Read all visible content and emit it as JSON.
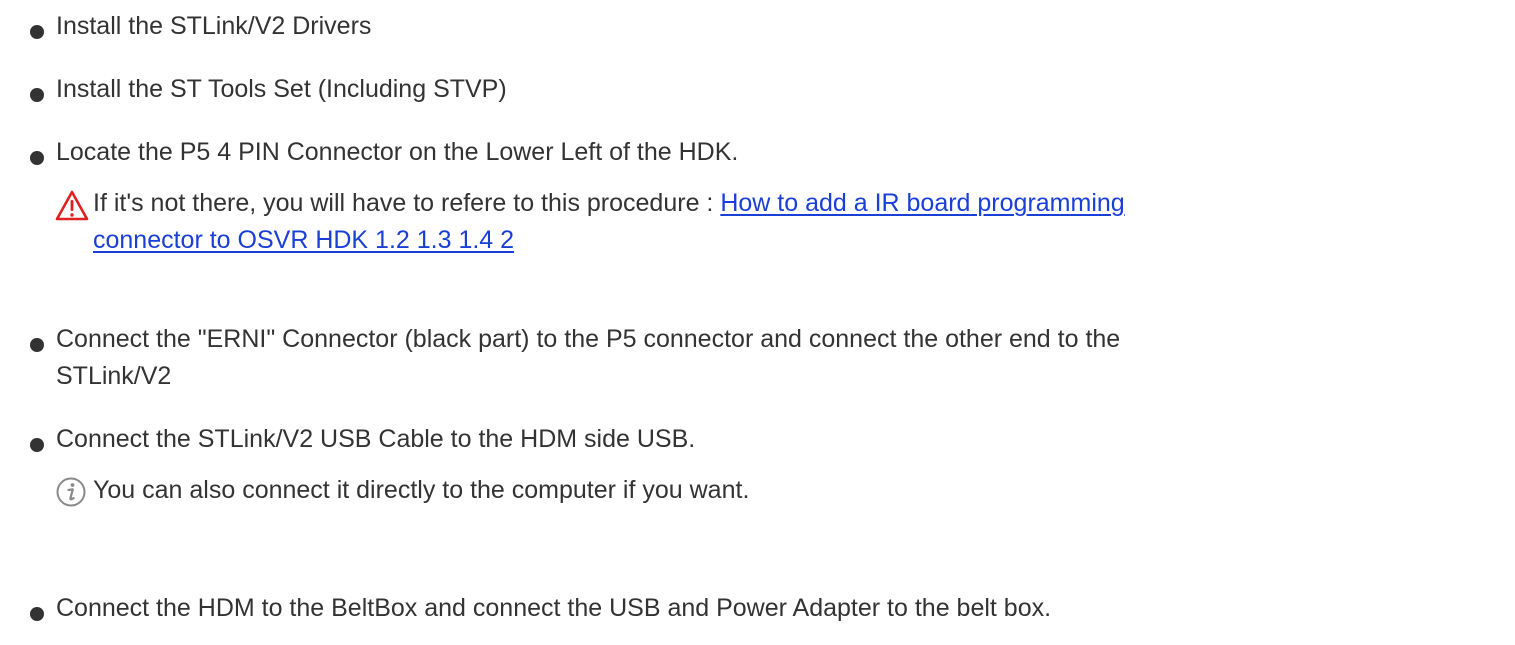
{
  "steps": [
    {
      "text": "Install the STLink/V2 Drivers"
    },
    {
      "text": "Install the ST Tools Set (Including STVP)"
    },
    {
      "text": "Locate the P5 4 PIN Connector on the Lower Left of the HDK."
    },
    {
      "text": "Connect the \"ERNI\" Connector (black part) to the P5 connector and connect the other end to the",
      "text_line2": "STLink/V2"
    },
    {
      "text": "Connect the STLink/V2 USB Cable to the HDM side USB."
    },
    {
      "text": "Connect the HDM to the BeltBox and connect the USB and Power Adapter to the belt box."
    }
  ],
  "warning_note": {
    "icon": "warning-icon",
    "color": "#e02020",
    "text": "If it's not there, you will have to refere to this procedure : ",
    "link_line1": "How to add a IR board programming",
    "link_line2": "connector to OSVR HDK 1.2 1.3 1.4 2",
    "link_color": "#1a3fd6"
  },
  "info_note": {
    "icon": "info-icon",
    "color": "#8a8a8a",
    "text": "You can also connect it directly to the computer if you want."
  }
}
